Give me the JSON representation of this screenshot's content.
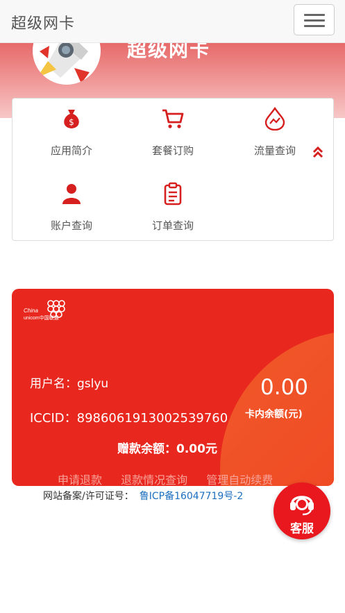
{
  "navbar": {
    "brand": "超级网卡"
  },
  "banner": {
    "title": "超级网卡"
  },
  "menu": {
    "items": [
      {
        "label": "应用简介",
        "icon": "money-bag-icon"
      },
      {
        "label": "套餐订购",
        "icon": "shopping-cart-icon"
      },
      {
        "label": "流量查询",
        "icon": "droplet-chart-icon"
      },
      {
        "label": "账户查询",
        "icon": "user-icon"
      },
      {
        "label": "订单查询",
        "icon": "clipboard-icon"
      }
    ],
    "collapse_icon": "double-chevron-up-icon"
  },
  "card": {
    "username": "用户名：gslyu",
    "iccid": "ICCID：89860619130025397​60",
    "balance_value": "0.00",
    "balance_label": "卡内余额(元)",
    "gift_balance": "赠款余额：0.00元",
    "links": [
      "申请退款",
      "退款情况查询",
      "管理自动续费"
    ],
    "brand_colors": {
      "primary": "#e8281e",
      "accent": "#f05a2a"
    }
  },
  "footer": {
    "icp_label": "网站备案/许可证号：",
    "icp_number": "鲁ICP备16047719号-2"
  },
  "service": {
    "label": "客服"
  }
}
